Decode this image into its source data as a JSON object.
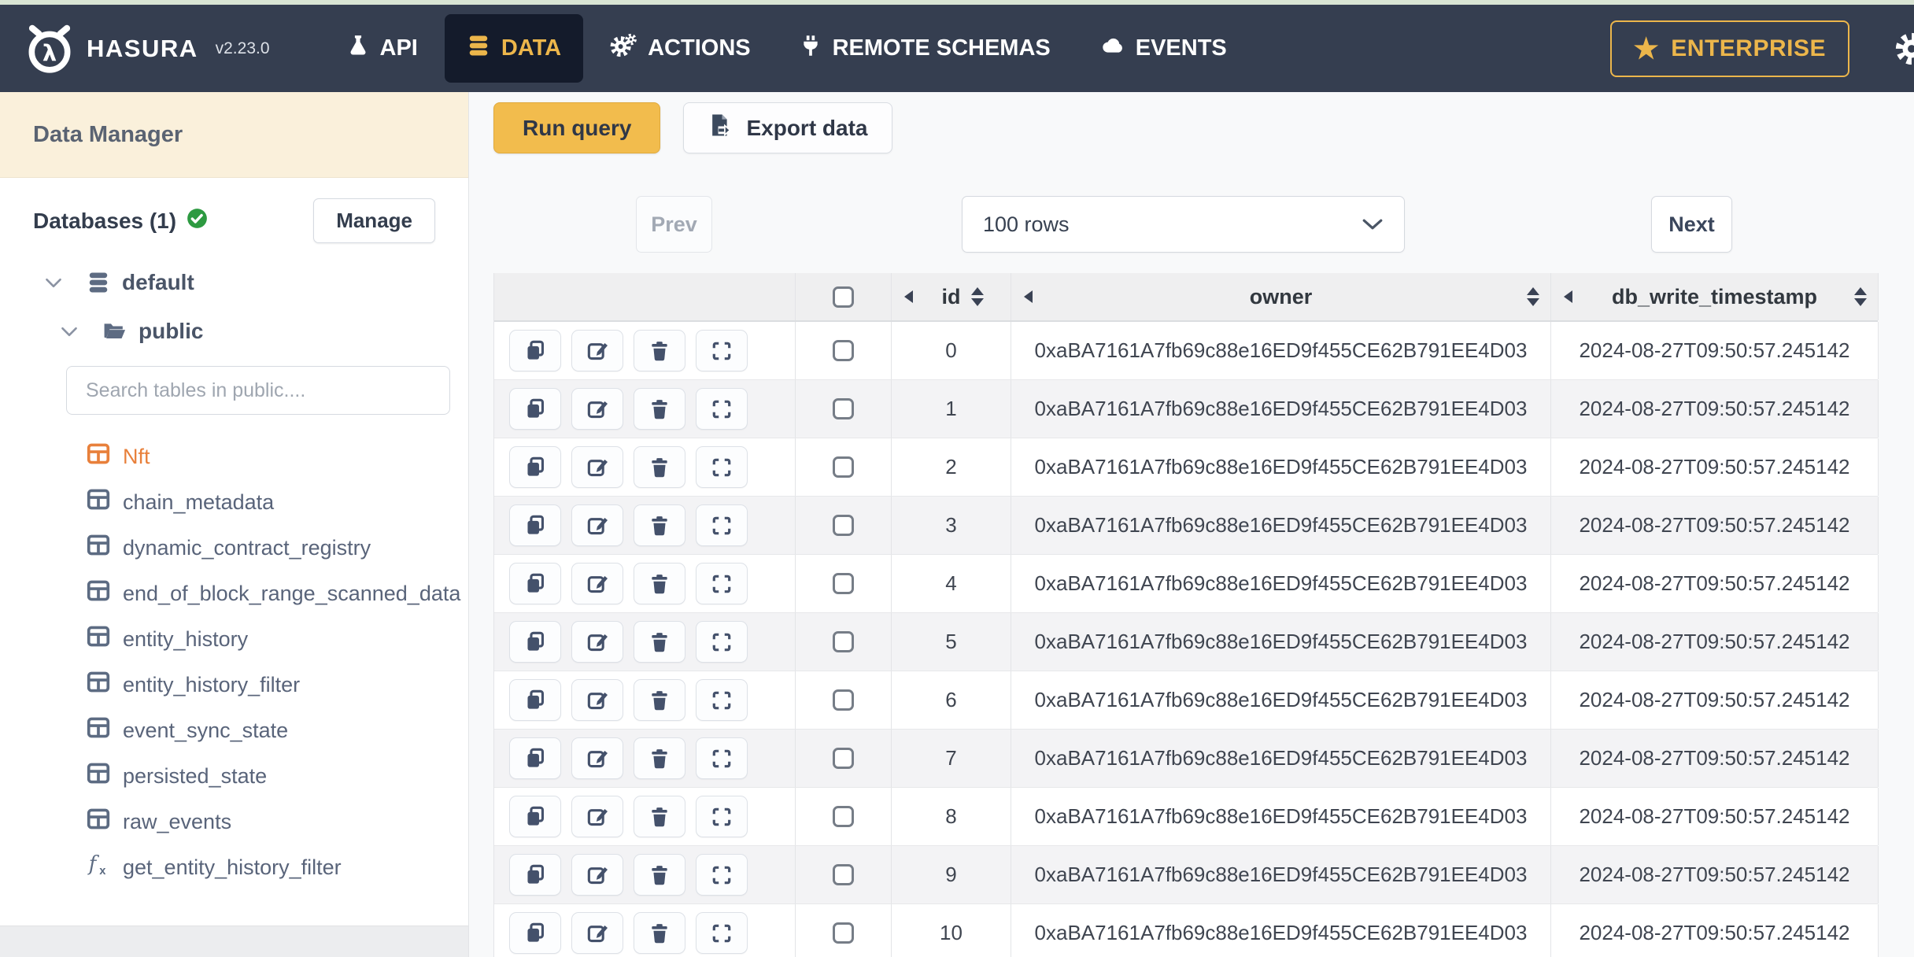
{
  "navbar": {
    "brand": "HASURA",
    "version": "v2.23.0",
    "items": [
      {
        "label": "API",
        "icon": "flask-icon",
        "active": false
      },
      {
        "label": "DATA",
        "icon": "database-icon",
        "active": true
      },
      {
        "label": "ACTIONS",
        "icon": "gears-icon",
        "active": false
      },
      {
        "label": "REMOTE SCHEMAS",
        "icon": "plug-icon",
        "active": false
      },
      {
        "label": "EVENTS",
        "icon": "cloud-icon",
        "active": false
      }
    ],
    "enterprise_label": "ENTERPRISE"
  },
  "sidebar": {
    "title": "Data Manager",
    "databases_label": "Databases (1)",
    "manage_label": "Manage",
    "database_name": "default",
    "schema_name": "public",
    "search_placeholder": "Search tables in public....",
    "tables": [
      {
        "name": "Nft",
        "selected": true
      },
      {
        "name": "chain_metadata",
        "selected": false
      },
      {
        "name": "dynamic_contract_registry",
        "selected": false
      },
      {
        "name": "end_of_block_range_scanned_data",
        "selected": false
      },
      {
        "name": "entity_history",
        "selected": false
      },
      {
        "name": "entity_history_filter",
        "selected": false
      },
      {
        "name": "event_sync_state",
        "selected": false
      },
      {
        "name": "persisted_state",
        "selected": false
      },
      {
        "name": "raw_events",
        "selected": false
      }
    ],
    "functions": [
      {
        "name": "get_entity_history_filter"
      }
    ]
  },
  "main": {
    "run_query_label": "Run query",
    "export_label": "Export data",
    "pagination": {
      "prev_label": "Prev",
      "rows_value": "100 rows",
      "next_label": "Next"
    },
    "table": {
      "columns": [
        "id",
        "owner",
        "db_write_timestamp"
      ],
      "rows": [
        {
          "id": "0",
          "owner": "0xaBA7161A7fb69c88e16ED9f455CE62B791EE4D03",
          "db_write_timestamp": "2024-08-27T09:50:57.245142"
        },
        {
          "id": "1",
          "owner": "0xaBA7161A7fb69c88e16ED9f455CE62B791EE4D03",
          "db_write_timestamp": "2024-08-27T09:50:57.245142"
        },
        {
          "id": "2",
          "owner": "0xaBA7161A7fb69c88e16ED9f455CE62B791EE4D03",
          "db_write_timestamp": "2024-08-27T09:50:57.245142"
        },
        {
          "id": "3",
          "owner": "0xaBA7161A7fb69c88e16ED9f455CE62B791EE4D03",
          "db_write_timestamp": "2024-08-27T09:50:57.245142"
        },
        {
          "id": "4",
          "owner": "0xaBA7161A7fb69c88e16ED9f455CE62B791EE4D03",
          "db_write_timestamp": "2024-08-27T09:50:57.245142"
        },
        {
          "id": "5",
          "owner": "0xaBA7161A7fb69c88e16ED9f455CE62B791EE4D03",
          "db_write_timestamp": "2024-08-27T09:50:57.245142"
        },
        {
          "id": "6",
          "owner": "0xaBA7161A7fb69c88e16ED9f455CE62B791EE4D03",
          "db_write_timestamp": "2024-08-27T09:50:57.245142"
        },
        {
          "id": "7",
          "owner": "0xaBA7161A7fb69c88e16ED9f455CE62B791EE4D03",
          "db_write_timestamp": "2024-08-27T09:50:57.245142"
        },
        {
          "id": "8",
          "owner": "0xaBA7161A7fb69c88e16ED9f455CE62B791EE4D03",
          "db_write_timestamp": "2024-08-27T09:50:57.245142"
        },
        {
          "id": "9",
          "owner": "0xaBA7161A7fb69c88e16ED9f455CE62B791EE4D03",
          "db_write_timestamp": "2024-08-27T09:50:57.245142"
        },
        {
          "id": "10",
          "owner": "0xaBA7161A7fb69c88e16ED9f455CE62B791EE4D03",
          "db_write_timestamp": "2024-08-27T09:50:57.245142"
        }
      ]
    }
  },
  "colors": {
    "accent_yellow": "#ECB64B",
    "navbar_bg": "#353E50",
    "active_tab_bg": "#141B2B",
    "selected_table_orange": "#E8803B",
    "sidebar_header_bg": "#FAF0DB",
    "success_green": "#2D9A41",
    "run_button_bg": "#F2BC4D"
  }
}
